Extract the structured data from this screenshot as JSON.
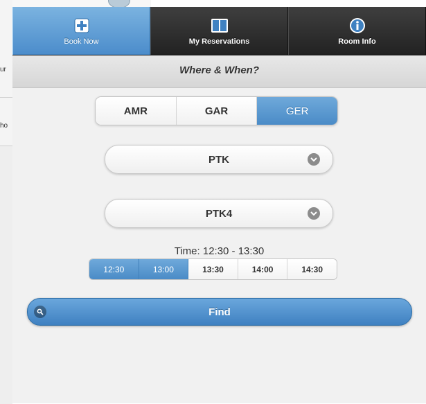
{
  "background": {
    "fragments": [
      "ur",
      "ho"
    ]
  },
  "nav": {
    "tabs": [
      {
        "label": "Book Now",
        "icon": "plus-icon",
        "active": true
      },
      {
        "label": "My Reservations",
        "icon": "book-icon",
        "active": false
      },
      {
        "label": "Room Info",
        "icon": "info-icon",
        "active": false
      }
    ]
  },
  "header": {
    "title": "Where & When?"
  },
  "region": {
    "options": [
      "AMR",
      "GAR",
      "GER"
    ],
    "selected": "GER"
  },
  "building": {
    "value": "PTK"
  },
  "room": {
    "value": "PTK4"
  },
  "time": {
    "label": "Time: 12:30 - 13:30",
    "slots": [
      "12:30",
      "13:00",
      "13:30",
      "14:00",
      "14:30"
    ],
    "selected": [
      "12:30",
      "13:00"
    ]
  },
  "find": {
    "label": "Find",
    "icon": "search-icon"
  },
  "colors": {
    "accent": "#4a8bc7",
    "navbar": "#2a2a2a",
    "page_bg": "#f1f1f1"
  }
}
